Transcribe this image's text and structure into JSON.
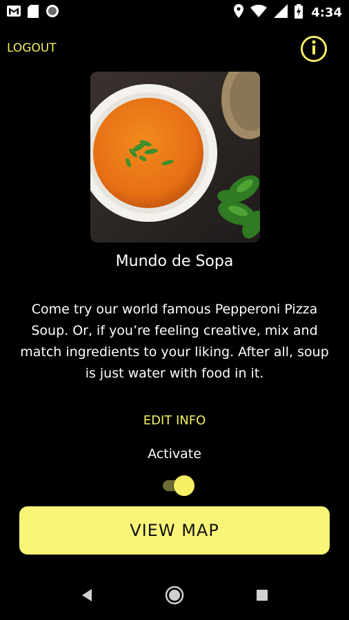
{
  "status_bar": {
    "time": "4:34",
    "icons": [
      "gmail-icon",
      "sd-card-icon",
      "sync-icon",
      "location-icon",
      "wifi-icon",
      "signal-icon",
      "battery-charging-icon"
    ]
  },
  "header": {
    "logout_label": "LOGOUT",
    "info_icon": "info-icon"
  },
  "restaurant": {
    "name": "Mundo de Sopa",
    "description": "Come try our world famous Pepperoni Pizza Soup. Or, if you’re feeling creative, mix and match ingredients to your liking. After all, soup is just water with food in it."
  },
  "actions": {
    "edit_info_label": "EDIT INFO",
    "activate_label": "Activate",
    "activate_on": true,
    "view_map_label": "VIEW MAP"
  },
  "colors": {
    "accent": "#f5ef63",
    "button_bg": "#faf578",
    "background": "#000000"
  },
  "nav_bar": {
    "icons": [
      "back-icon",
      "home-icon",
      "recents-icon"
    ]
  }
}
